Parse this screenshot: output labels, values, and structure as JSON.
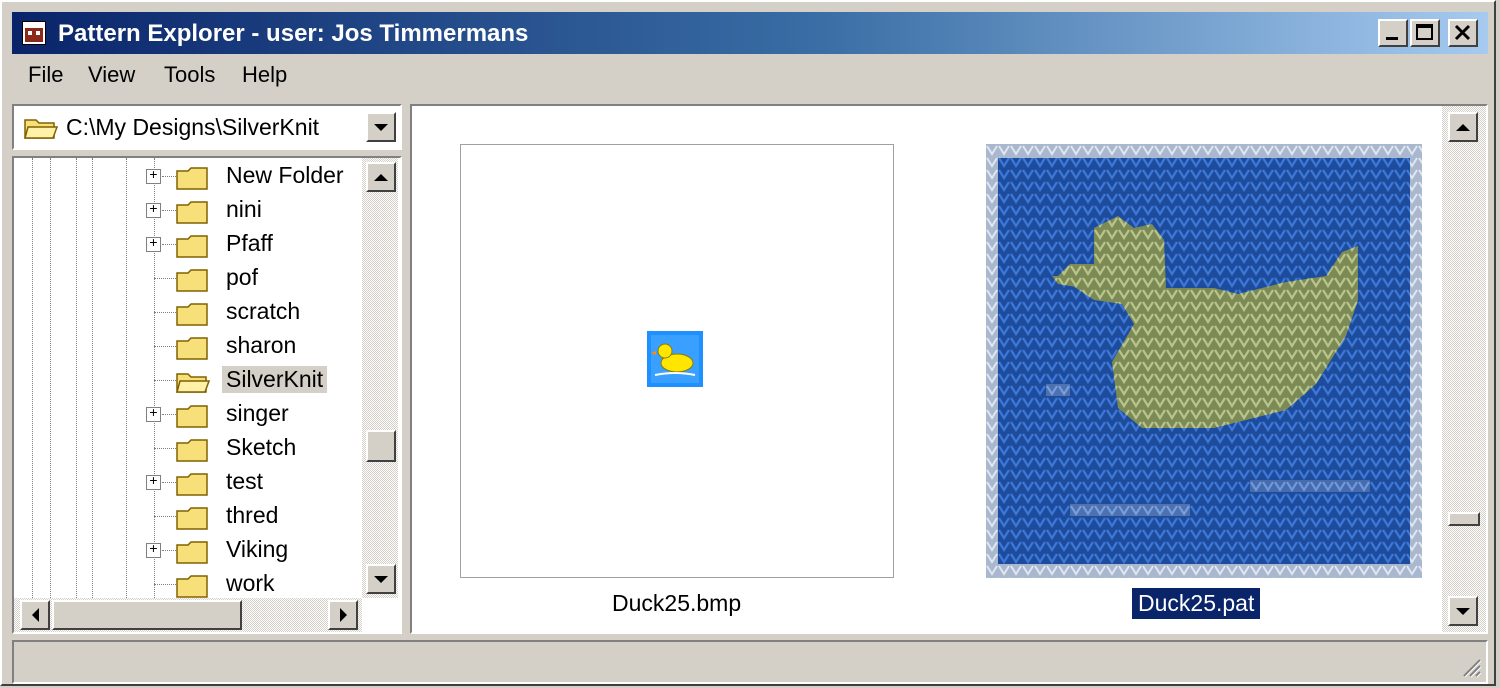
{
  "window": {
    "title": "Pattern Explorer - user: Jos Timmermans",
    "controls": {
      "minimize_icon": "minimize-icon",
      "maximize_icon": "maximize-icon",
      "close_icon": "close-icon"
    }
  },
  "menu": [
    {
      "label": "File"
    },
    {
      "label": "View"
    },
    {
      "label": "Tools"
    },
    {
      "label": "Help"
    }
  ],
  "path_combo": {
    "value": "C:\\My Designs\\SilverKnit",
    "icon": "folder-open-icon"
  },
  "tree": {
    "items": [
      {
        "label": "New Folder",
        "expandable": true,
        "selected": false
      },
      {
        "label": "nini",
        "expandable": true,
        "selected": false
      },
      {
        "label": "Pfaff",
        "expandable": true,
        "selected": false
      },
      {
        "label": "pof",
        "expandable": false,
        "selected": false
      },
      {
        "label": "scratch",
        "expandable": false,
        "selected": false
      },
      {
        "label": "sharon",
        "expandable": false,
        "selected": false
      },
      {
        "label": "SilverKnit",
        "expandable": false,
        "selected": true
      },
      {
        "label": "singer",
        "expandable": true,
        "selected": false
      },
      {
        "label": "Sketch",
        "expandable": false,
        "selected": false
      },
      {
        "label": "test",
        "expandable": true,
        "selected": false
      },
      {
        "label": "thred",
        "expandable": false,
        "selected": false
      },
      {
        "label": "Viking",
        "expandable": true,
        "selected": false
      },
      {
        "label": "work",
        "expandable": false,
        "selected": false
      }
    ],
    "expander_symbol": "+"
  },
  "files": [
    {
      "name": "Duck25.bmp",
      "selected": false,
      "icon": "duck-icon"
    },
    {
      "name": "Duck25.pat",
      "selected": true,
      "icon": "knit-duck-preview"
    }
  ],
  "status": {
    "text": ""
  },
  "colors": {
    "titlebar_start": "#0a246a",
    "titlebar_end": "#a6caf0",
    "selection": "#0a246a",
    "knit_background": "#1e4c9c",
    "knit_duck": "#9ca86a",
    "folder_yellow": "#f7e07a"
  }
}
